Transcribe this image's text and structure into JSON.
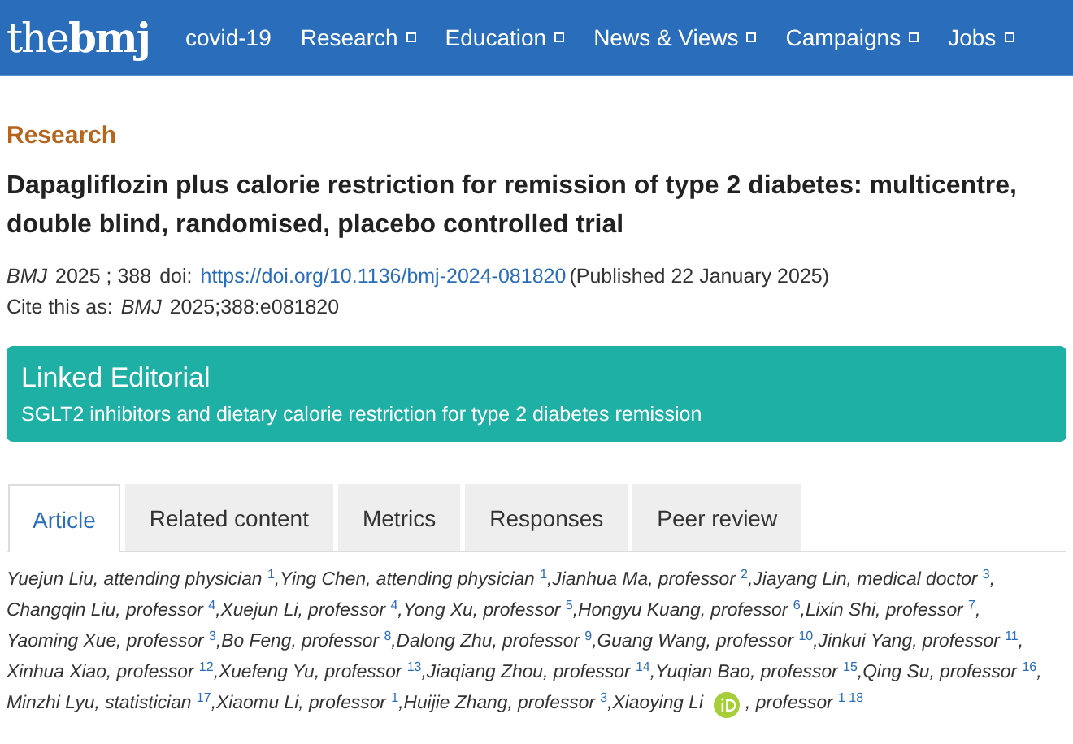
{
  "logo": {
    "prefix": "the",
    "name": "bmj"
  },
  "nav": [
    {
      "label": "covid-19",
      "has_menu": false
    },
    {
      "label": "Research",
      "has_menu": true
    },
    {
      "label": "Education",
      "has_menu": true
    },
    {
      "label": "News & Views",
      "has_menu": true
    },
    {
      "label": "Campaigns",
      "has_menu": true
    },
    {
      "label": "Jobs",
      "has_menu": true
    }
  ],
  "section": "Research",
  "title": "Dapagliflozin plus calorie restriction for remission of type 2 diabetes: multicentre, double blind, randomised, placebo controlled trial",
  "citation": {
    "journal": "BMJ",
    "volume": "2025 ; 388",
    "doi_label": "doi:",
    "doi": "https://doi.org/10.1136/bmj-2024-081820",
    "published": "(Published 22 January 2025)",
    "cite_label": "Cite this as:",
    "cite_journal": "BMJ",
    "cite_ref": "2025;388:e081820"
  },
  "linked_editorial": {
    "heading": "Linked Editorial",
    "link": "SGLT2 inhibitors and dietary calorie restriction for type 2 diabetes remission"
  },
  "tabs": [
    {
      "label": "Article",
      "selected": true
    },
    {
      "label": "Related content",
      "selected": false
    },
    {
      "label": "Metrics",
      "selected": false
    },
    {
      "label": "Responses",
      "selected": false
    },
    {
      "label": "Peer review",
      "selected": false
    }
  ],
  "author_lines": [
    [
      {
        "kind": "text",
        "text": "Yuejun Liu, attending physician $^{1}$,Ying Chen, attending physician $^{1}$,Jianhua Ma, professor $^{2}$,Jiayang Lin, medical doctor $^{3}$,"
      }
    ],
    [
      {
        "kind": "text",
        "text": "Changqin Liu, professor $^{4}$,Xuejun Li, professor $^{4}$,Yong Xu, professor $^{5}$,Hongyu Kuang, professor $^{6}$,Lixin Shi, professor $^{7}$,"
      }
    ],
    [
      {
        "kind": "text",
        "text": "Yaoming Xue, professor $^{3}$,Bo Feng, professor $^{8}$,Dalong Zhu, professor $^{9}$,Guang Wang, professor $^{10}$,Jinkui Yang, professor $^{11}$,"
      }
    ],
    [
      {
        "kind": "text",
        "text": "Xinhua Xiao, professor $^{12}$,Xuefeng Yu, professor $^{13}$,Jiaqiang Zhou, professor $^{14}$,Yuqian Bao, professor $^{15}$,Qing Su, professor $^{16}$,"
      }
    ],
    [
      {
        "kind": "text",
        "text": "Minzhi Lyu, statistician $^{17}$,Xiaomu Li, professor $^{1}$,Huijie Zhang, professor $^{3}$,Xiaoying Li"
      },
      {
        "kind": "orcid"
      },
      {
        "kind": "text",
        "text": ", professor $^{1 18}$"
      }
    ]
  ]
}
